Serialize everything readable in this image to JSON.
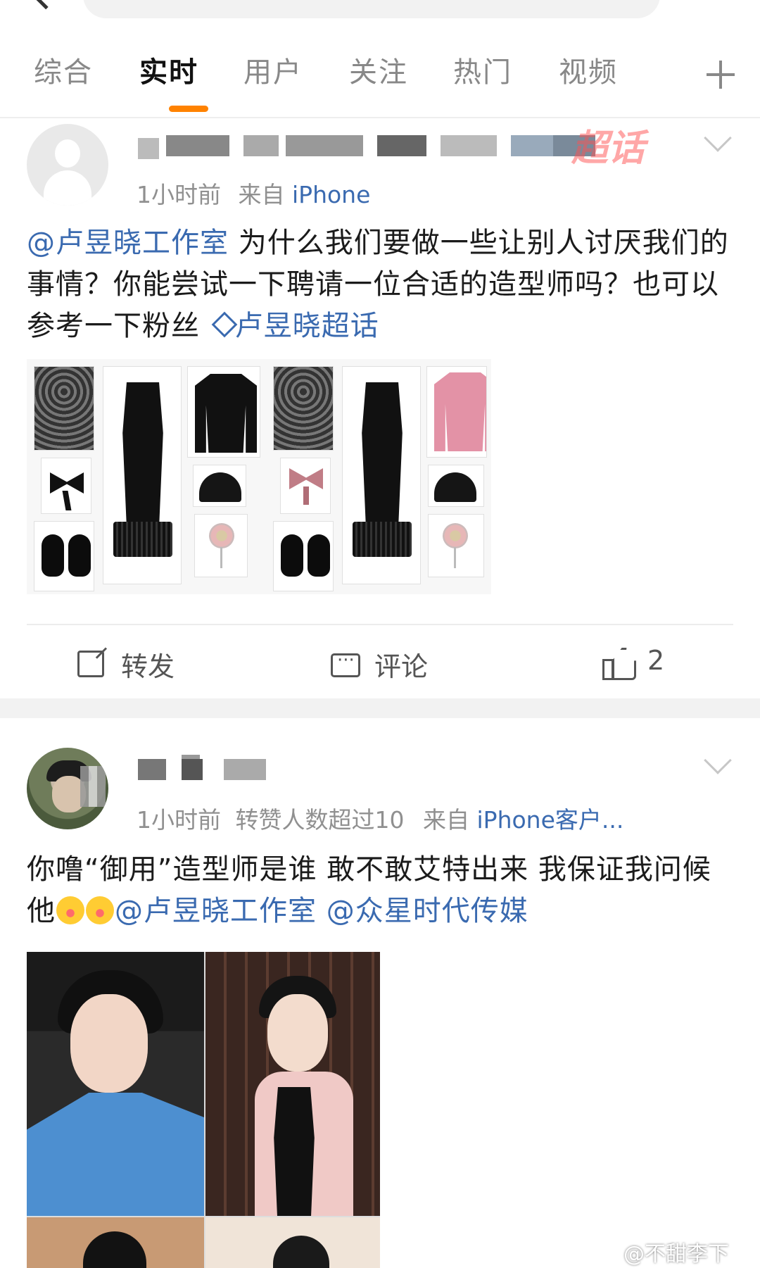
{
  "tabs": [
    {
      "label": "综合",
      "active": false
    },
    {
      "label": "实时",
      "active": true
    },
    {
      "label": "用户",
      "active": false
    },
    {
      "label": "关注",
      "active": false
    },
    {
      "label": "热门",
      "active": false
    },
    {
      "label": "视频",
      "active": false
    }
  ],
  "accent_color": "#ff8200",
  "link_color": "#3a6ab0",
  "posts": [
    {
      "time": "1小时前",
      "from_label": "来自",
      "source": "iPhone",
      "text_mention": "@卢昱晓工作室",
      "text_body": "为什么我们要做一些让别人讨厌我们的事情？你能尝试一下聘请一位合适的造型师吗？也可以参考一下粉丝",
      "text_topic": "卢昱晓超话",
      "topic_badge": "超话",
      "actions": {
        "repost": "转发",
        "comment": "评论",
        "like_count": "2"
      }
    },
    {
      "time": "1小时前",
      "extra": "转赞人数超过10",
      "from_label": "来自",
      "source": "iPhone客户...",
      "text_body": "你噜“御用”造型师是谁 敢不敢艾特出来 我保证我问候他",
      "mention_1": "@卢昱晓工作室",
      "mention_2": "@众星时代传媒"
    }
  ],
  "watermark": "@不甜李下"
}
